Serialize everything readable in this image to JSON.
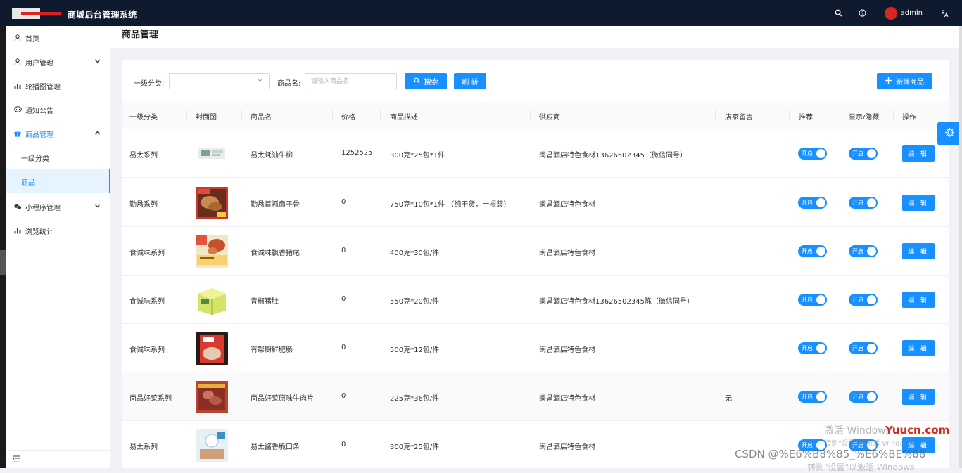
{
  "app": {
    "title": "商城后台管理系统",
    "user": "admin"
  },
  "top_icons": [
    "search-icon",
    "help-icon",
    "translate-icon"
  ],
  "sidebar": {
    "items": [
      {
        "label": "首页",
        "icon": "user-icon"
      },
      {
        "label": "用户管理",
        "icon": "user-icon",
        "expandable": true
      },
      {
        "label": "轮播图管理",
        "icon": "chart-bar-icon"
      },
      {
        "label": "通知公告",
        "icon": "chat-icon"
      },
      {
        "label": "商品管理",
        "icon": "gift-icon",
        "expanded": true
      },
      {
        "label": "一级分类",
        "sub": true
      },
      {
        "label": "商品",
        "sub": true,
        "active": true
      },
      {
        "label": "小程序管理",
        "icon": "wechat-icon",
        "expandable": true
      },
      {
        "label": "浏览统计",
        "icon": "chart-bar-icon"
      }
    ]
  },
  "page": {
    "title": "商品管理"
  },
  "filters": {
    "category_label": "一级分类:",
    "category_value": "",
    "name_label": "商品名:",
    "name_placeholder": "请输入商品名",
    "search_btn": "搜索",
    "refresh_btn": "刷 新",
    "add_btn": "新增商品"
  },
  "table": {
    "columns": [
      "一级分类",
      "封面图",
      "商品名",
      "价格",
      "商品描述",
      "供应商",
      "店家留言",
      "推荐",
      "显示/隐藏",
      "操作"
    ],
    "switch_label": "开启",
    "edit_label": "编 辑",
    "rows": [
      {
        "category": "易太系列",
        "name": "易太蚝油牛柳",
        "price": "1252525",
        "desc": "300克*25包*1件",
        "supplier": "闽昌酒店特色食材13626502345（微信同号）",
        "note": ""
      },
      {
        "category": "勤恳系列",
        "name": "勤恳首抓扇子骨",
        "price": "0",
        "desc": "750克*10包*1件 （纯干货，十根装）",
        "supplier": "闽昌酒店特色食材",
        "note": ""
      },
      {
        "category": "食诚味系列",
        "name": "食诚味飘香猪尾",
        "price": "0",
        "desc": "400克*30包/件",
        "supplier": "闽昌酒店特色食材",
        "note": ""
      },
      {
        "category": "食诚味系列",
        "name": "青椒猪肚",
        "price": "0",
        "desc": "550克*20包/件",
        "supplier": "闽昌酒店特色食材13626502345陈（微信同号）",
        "note": ""
      },
      {
        "category": "食诚味系列",
        "name": "有帮厨鲜肥肠",
        "price": "0",
        "desc": "500克*12包/件",
        "supplier": "闽昌酒店特色食材",
        "note": ""
      },
      {
        "category": "尚品好菜系列",
        "name": "尚品好菜原味牛肉片",
        "price": "0",
        "desc": "225克*36包/件",
        "supplier": "闽昌酒店特色食材",
        "note": "无"
      },
      {
        "category": "易太系列",
        "name": "易太酱香脆口条",
        "price": "0",
        "desc": "300克*25包/件",
        "supplier": "闽昌酒店特色食材",
        "note": ""
      }
    ]
  },
  "watermarks": {
    "activate": "激活 Windows",
    "activate_hint": "转到\"设置\"以激活 Windows。",
    "activate_bottom": "转到\"设置\"以激活 Windows",
    "yuucn": "Yuucn.com",
    "csdn": "CSDN @%E6%B8%85_%E6%BE%88"
  },
  "colors": {
    "primary": "#1890ff",
    "topbar": "#0e1a2e"
  }
}
